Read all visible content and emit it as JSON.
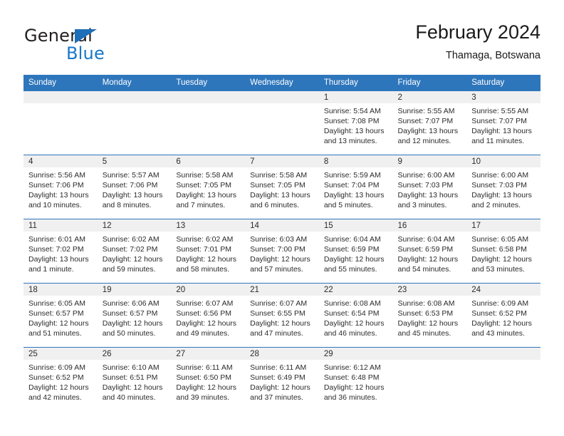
{
  "brand": {
    "name_part1": "General",
    "name_part2": "Blue",
    "logo_icon": "triangle-icon"
  },
  "header": {
    "title": "February 2024",
    "subtitle": "Thamaga, Botswana"
  },
  "theme": {
    "header_blue": "#2e76bc",
    "band_gray": "#f0f0f0",
    "text": "#2b2b2b",
    "brand_blue": "#1877c9"
  },
  "calendar": {
    "weekday_headers": [
      "Sunday",
      "Monday",
      "Tuesday",
      "Wednesday",
      "Thursday",
      "Friday",
      "Saturday"
    ],
    "weeks": [
      [
        {
          "empty": true
        },
        {
          "empty": true
        },
        {
          "empty": true
        },
        {
          "empty": true
        },
        {
          "day": "1",
          "sunrise": "Sunrise: 5:54 AM",
          "sunset": "Sunset: 7:08 PM",
          "daylight_line1": "Daylight: 13 hours",
          "daylight_line2": "and 13 minutes."
        },
        {
          "day": "2",
          "sunrise": "Sunrise: 5:55 AM",
          "sunset": "Sunset: 7:07 PM",
          "daylight_line1": "Daylight: 13 hours",
          "daylight_line2": "and 12 minutes."
        },
        {
          "day": "3",
          "sunrise": "Sunrise: 5:55 AM",
          "sunset": "Sunset: 7:07 PM",
          "daylight_line1": "Daylight: 13 hours",
          "daylight_line2": "and 11 minutes."
        }
      ],
      [
        {
          "day": "4",
          "sunrise": "Sunrise: 5:56 AM",
          "sunset": "Sunset: 7:06 PM",
          "daylight_line1": "Daylight: 13 hours",
          "daylight_line2": "and 10 minutes."
        },
        {
          "day": "5",
          "sunrise": "Sunrise: 5:57 AM",
          "sunset": "Sunset: 7:06 PM",
          "daylight_line1": "Daylight: 13 hours",
          "daylight_line2": "and 8 minutes."
        },
        {
          "day": "6",
          "sunrise": "Sunrise: 5:58 AM",
          "sunset": "Sunset: 7:05 PM",
          "daylight_line1": "Daylight: 13 hours",
          "daylight_line2": "and 7 minutes."
        },
        {
          "day": "7",
          "sunrise": "Sunrise: 5:58 AM",
          "sunset": "Sunset: 7:05 PM",
          "daylight_line1": "Daylight: 13 hours",
          "daylight_line2": "and 6 minutes."
        },
        {
          "day": "8",
          "sunrise": "Sunrise: 5:59 AM",
          "sunset": "Sunset: 7:04 PM",
          "daylight_line1": "Daylight: 13 hours",
          "daylight_line2": "and 5 minutes."
        },
        {
          "day": "9",
          "sunrise": "Sunrise: 6:00 AM",
          "sunset": "Sunset: 7:03 PM",
          "daylight_line1": "Daylight: 13 hours",
          "daylight_line2": "and 3 minutes."
        },
        {
          "day": "10",
          "sunrise": "Sunrise: 6:00 AM",
          "sunset": "Sunset: 7:03 PM",
          "daylight_line1": "Daylight: 13 hours",
          "daylight_line2": "and 2 minutes."
        }
      ],
      [
        {
          "day": "11",
          "sunrise": "Sunrise: 6:01 AM",
          "sunset": "Sunset: 7:02 PM",
          "daylight_line1": "Daylight: 13 hours",
          "daylight_line2": "and 1 minute."
        },
        {
          "day": "12",
          "sunrise": "Sunrise: 6:02 AM",
          "sunset": "Sunset: 7:02 PM",
          "daylight_line1": "Daylight: 12 hours",
          "daylight_line2": "and 59 minutes."
        },
        {
          "day": "13",
          "sunrise": "Sunrise: 6:02 AM",
          "sunset": "Sunset: 7:01 PM",
          "daylight_line1": "Daylight: 12 hours",
          "daylight_line2": "and 58 minutes."
        },
        {
          "day": "14",
          "sunrise": "Sunrise: 6:03 AM",
          "sunset": "Sunset: 7:00 PM",
          "daylight_line1": "Daylight: 12 hours",
          "daylight_line2": "and 57 minutes."
        },
        {
          "day": "15",
          "sunrise": "Sunrise: 6:04 AM",
          "sunset": "Sunset: 6:59 PM",
          "daylight_line1": "Daylight: 12 hours",
          "daylight_line2": "and 55 minutes."
        },
        {
          "day": "16",
          "sunrise": "Sunrise: 6:04 AM",
          "sunset": "Sunset: 6:59 PM",
          "daylight_line1": "Daylight: 12 hours",
          "daylight_line2": "and 54 minutes."
        },
        {
          "day": "17",
          "sunrise": "Sunrise: 6:05 AM",
          "sunset": "Sunset: 6:58 PM",
          "daylight_line1": "Daylight: 12 hours",
          "daylight_line2": "and 53 minutes."
        }
      ],
      [
        {
          "day": "18",
          "sunrise": "Sunrise: 6:05 AM",
          "sunset": "Sunset: 6:57 PM",
          "daylight_line1": "Daylight: 12 hours",
          "daylight_line2": "and 51 minutes."
        },
        {
          "day": "19",
          "sunrise": "Sunrise: 6:06 AM",
          "sunset": "Sunset: 6:57 PM",
          "daylight_line1": "Daylight: 12 hours",
          "daylight_line2": "and 50 minutes."
        },
        {
          "day": "20",
          "sunrise": "Sunrise: 6:07 AM",
          "sunset": "Sunset: 6:56 PM",
          "daylight_line1": "Daylight: 12 hours",
          "daylight_line2": "and 49 minutes."
        },
        {
          "day": "21",
          "sunrise": "Sunrise: 6:07 AM",
          "sunset": "Sunset: 6:55 PM",
          "daylight_line1": "Daylight: 12 hours",
          "daylight_line2": "and 47 minutes."
        },
        {
          "day": "22",
          "sunrise": "Sunrise: 6:08 AM",
          "sunset": "Sunset: 6:54 PM",
          "daylight_line1": "Daylight: 12 hours",
          "daylight_line2": "and 46 minutes."
        },
        {
          "day": "23",
          "sunrise": "Sunrise: 6:08 AM",
          "sunset": "Sunset: 6:53 PM",
          "daylight_line1": "Daylight: 12 hours",
          "daylight_line2": "and 45 minutes."
        },
        {
          "day": "24",
          "sunrise": "Sunrise: 6:09 AM",
          "sunset": "Sunset: 6:52 PM",
          "daylight_line1": "Daylight: 12 hours",
          "daylight_line2": "and 43 minutes."
        }
      ],
      [
        {
          "day": "25",
          "sunrise": "Sunrise: 6:09 AM",
          "sunset": "Sunset: 6:52 PM",
          "daylight_line1": "Daylight: 12 hours",
          "daylight_line2": "and 42 minutes."
        },
        {
          "day": "26",
          "sunrise": "Sunrise: 6:10 AM",
          "sunset": "Sunset: 6:51 PM",
          "daylight_line1": "Daylight: 12 hours",
          "daylight_line2": "and 40 minutes."
        },
        {
          "day": "27",
          "sunrise": "Sunrise: 6:11 AM",
          "sunset": "Sunset: 6:50 PM",
          "daylight_line1": "Daylight: 12 hours",
          "daylight_line2": "and 39 minutes."
        },
        {
          "day": "28",
          "sunrise": "Sunrise: 6:11 AM",
          "sunset": "Sunset: 6:49 PM",
          "daylight_line1": "Daylight: 12 hours",
          "daylight_line2": "and 37 minutes."
        },
        {
          "day": "29",
          "sunrise": "Sunrise: 6:12 AM",
          "sunset": "Sunset: 6:48 PM",
          "daylight_line1": "Daylight: 12 hours",
          "daylight_line2": "and 36 minutes."
        },
        {
          "empty": true
        },
        {
          "empty": true
        }
      ]
    ]
  }
}
